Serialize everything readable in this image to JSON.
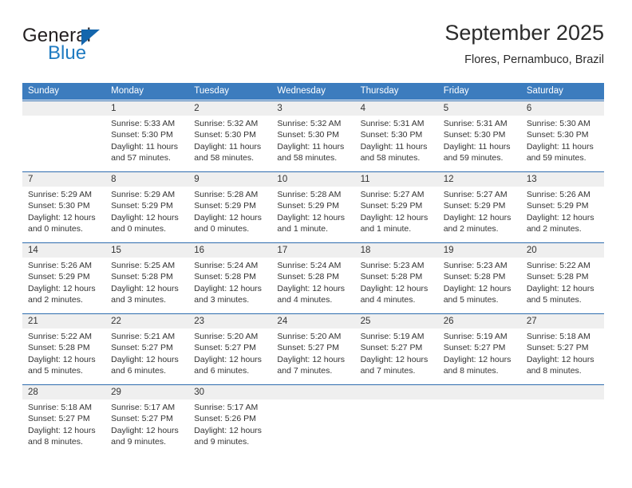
{
  "brand": {
    "name_part1": "General",
    "name_part2": "Blue",
    "triangle_icon": "triangle-icon",
    "accent_color": "#1466ad",
    "blue_text_color": "#1f7bc1"
  },
  "header": {
    "title": "September 2025",
    "location": "Flores, Pernambuco, Brazil"
  },
  "calendar": {
    "header_bg": "#3c7cbe",
    "number_strip_bg": "#efefef",
    "weekdays": [
      "Sunday",
      "Monday",
      "Tuesday",
      "Wednesday",
      "Thursday",
      "Friday",
      "Saturday"
    ],
    "weeks": [
      [
        {
          "day": "",
          "sunrise": "",
          "sunset": "",
          "daylight_line1": "",
          "daylight_line2": ""
        },
        {
          "day": "1",
          "sunrise": "Sunrise: 5:33 AM",
          "sunset": "Sunset: 5:30 PM",
          "daylight_line1": "Daylight: 11 hours",
          "daylight_line2": "and 57 minutes."
        },
        {
          "day": "2",
          "sunrise": "Sunrise: 5:32 AM",
          "sunset": "Sunset: 5:30 PM",
          "daylight_line1": "Daylight: 11 hours",
          "daylight_line2": "and 58 minutes."
        },
        {
          "day": "3",
          "sunrise": "Sunrise: 5:32 AM",
          "sunset": "Sunset: 5:30 PM",
          "daylight_line1": "Daylight: 11 hours",
          "daylight_line2": "and 58 minutes."
        },
        {
          "day": "4",
          "sunrise": "Sunrise: 5:31 AM",
          "sunset": "Sunset: 5:30 PM",
          "daylight_line1": "Daylight: 11 hours",
          "daylight_line2": "and 58 minutes."
        },
        {
          "day": "5",
          "sunrise": "Sunrise: 5:31 AM",
          "sunset": "Sunset: 5:30 PM",
          "daylight_line1": "Daylight: 11 hours",
          "daylight_line2": "and 59 minutes."
        },
        {
          "day": "6",
          "sunrise": "Sunrise: 5:30 AM",
          "sunset": "Sunset: 5:30 PM",
          "daylight_line1": "Daylight: 11 hours",
          "daylight_line2": "and 59 minutes."
        }
      ],
      [
        {
          "day": "7",
          "sunrise": "Sunrise: 5:29 AM",
          "sunset": "Sunset: 5:30 PM",
          "daylight_line1": "Daylight: 12 hours",
          "daylight_line2": "and 0 minutes."
        },
        {
          "day": "8",
          "sunrise": "Sunrise: 5:29 AM",
          "sunset": "Sunset: 5:29 PM",
          "daylight_line1": "Daylight: 12 hours",
          "daylight_line2": "and 0 minutes."
        },
        {
          "day": "9",
          "sunrise": "Sunrise: 5:28 AM",
          "sunset": "Sunset: 5:29 PM",
          "daylight_line1": "Daylight: 12 hours",
          "daylight_line2": "and 0 minutes."
        },
        {
          "day": "10",
          "sunrise": "Sunrise: 5:28 AM",
          "sunset": "Sunset: 5:29 PM",
          "daylight_line1": "Daylight: 12 hours",
          "daylight_line2": "and 1 minute."
        },
        {
          "day": "11",
          "sunrise": "Sunrise: 5:27 AM",
          "sunset": "Sunset: 5:29 PM",
          "daylight_line1": "Daylight: 12 hours",
          "daylight_line2": "and 1 minute."
        },
        {
          "day": "12",
          "sunrise": "Sunrise: 5:27 AM",
          "sunset": "Sunset: 5:29 PM",
          "daylight_line1": "Daylight: 12 hours",
          "daylight_line2": "and 2 minutes."
        },
        {
          "day": "13",
          "sunrise": "Sunrise: 5:26 AM",
          "sunset": "Sunset: 5:29 PM",
          "daylight_line1": "Daylight: 12 hours",
          "daylight_line2": "and 2 minutes."
        }
      ],
      [
        {
          "day": "14",
          "sunrise": "Sunrise: 5:26 AM",
          "sunset": "Sunset: 5:29 PM",
          "daylight_line1": "Daylight: 12 hours",
          "daylight_line2": "and 2 minutes."
        },
        {
          "day": "15",
          "sunrise": "Sunrise: 5:25 AM",
          "sunset": "Sunset: 5:28 PM",
          "daylight_line1": "Daylight: 12 hours",
          "daylight_line2": "and 3 minutes."
        },
        {
          "day": "16",
          "sunrise": "Sunrise: 5:24 AM",
          "sunset": "Sunset: 5:28 PM",
          "daylight_line1": "Daylight: 12 hours",
          "daylight_line2": "and 3 minutes."
        },
        {
          "day": "17",
          "sunrise": "Sunrise: 5:24 AM",
          "sunset": "Sunset: 5:28 PM",
          "daylight_line1": "Daylight: 12 hours",
          "daylight_line2": "and 4 minutes."
        },
        {
          "day": "18",
          "sunrise": "Sunrise: 5:23 AM",
          "sunset": "Sunset: 5:28 PM",
          "daylight_line1": "Daylight: 12 hours",
          "daylight_line2": "and 4 minutes."
        },
        {
          "day": "19",
          "sunrise": "Sunrise: 5:23 AM",
          "sunset": "Sunset: 5:28 PM",
          "daylight_line1": "Daylight: 12 hours",
          "daylight_line2": "and 5 minutes."
        },
        {
          "day": "20",
          "sunrise": "Sunrise: 5:22 AM",
          "sunset": "Sunset: 5:28 PM",
          "daylight_line1": "Daylight: 12 hours",
          "daylight_line2": "and 5 minutes."
        }
      ],
      [
        {
          "day": "21",
          "sunrise": "Sunrise: 5:22 AM",
          "sunset": "Sunset: 5:28 PM",
          "daylight_line1": "Daylight: 12 hours",
          "daylight_line2": "and 5 minutes."
        },
        {
          "day": "22",
          "sunrise": "Sunrise: 5:21 AM",
          "sunset": "Sunset: 5:27 PM",
          "daylight_line1": "Daylight: 12 hours",
          "daylight_line2": "and 6 minutes."
        },
        {
          "day": "23",
          "sunrise": "Sunrise: 5:20 AM",
          "sunset": "Sunset: 5:27 PM",
          "daylight_line1": "Daylight: 12 hours",
          "daylight_line2": "and 6 minutes."
        },
        {
          "day": "24",
          "sunrise": "Sunrise: 5:20 AM",
          "sunset": "Sunset: 5:27 PM",
          "daylight_line1": "Daylight: 12 hours",
          "daylight_line2": "and 7 minutes."
        },
        {
          "day": "25",
          "sunrise": "Sunrise: 5:19 AM",
          "sunset": "Sunset: 5:27 PM",
          "daylight_line1": "Daylight: 12 hours",
          "daylight_line2": "and 7 minutes."
        },
        {
          "day": "26",
          "sunrise": "Sunrise: 5:19 AM",
          "sunset": "Sunset: 5:27 PM",
          "daylight_line1": "Daylight: 12 hours",
          "daylight_line2": "and 8 minutes."
        },
        {
          "day": "27",
          "sunrise": "Sunrise: 5:18 AM",
          "sunset": "Sunset: 5:27 PM",
          "daylight_line1": "Daylight: 12 hours",
          "daylight_line2": "and 8 minutes."
        }
      ],
      [
        {
          "day": "28",
          "sunrise": "Sunrise: 5:18 AM",
          "sunset": "Sunset: 5:27 PM",
          "daylight_line1": "Daylight: 12 hours",
          "daylight_line2": "and 8 minutes."
        },
        {
          "day": "29",
          "sunrise": "Sunrise: 5:17 AM",
          "sunset": "Sunset: 5:27 PM",
          "daylight_line1": "Daylight: 12 hours",
          "daylight_line2": "and 9 minutes."
        },
        {
          "day": "30",
          "sunrise": "Sunrise: 5:17 AM",
          "sunset": "Sunset: 5:26 PM",
          "daylight_line1": "Daylight: 12 hours",
          "daylight_line2": "and 9 minutes."
        },
        {
          "day": "",
          "sunrise": "",
          "sunset": "",
          "daylight_line1": "",
          "daylight_line2": ""
        },
        {
          "day": "",
          "sunrise": "",
          "sunset": "",
          "daylight_line1": "",
          "daylight_line2": ""
        },
        {
          "day": "",
          "sunrise": "",
          "sunset": "",
          "daylight_line1": "",
          "daylight_line2": ""
        },
        {
          "day": "",
          "sunrise": "",
          "sunset": "",
          "daylight_line1": "",
          "daylight_line2": ""
        }
      ]
    ]
  }
}
